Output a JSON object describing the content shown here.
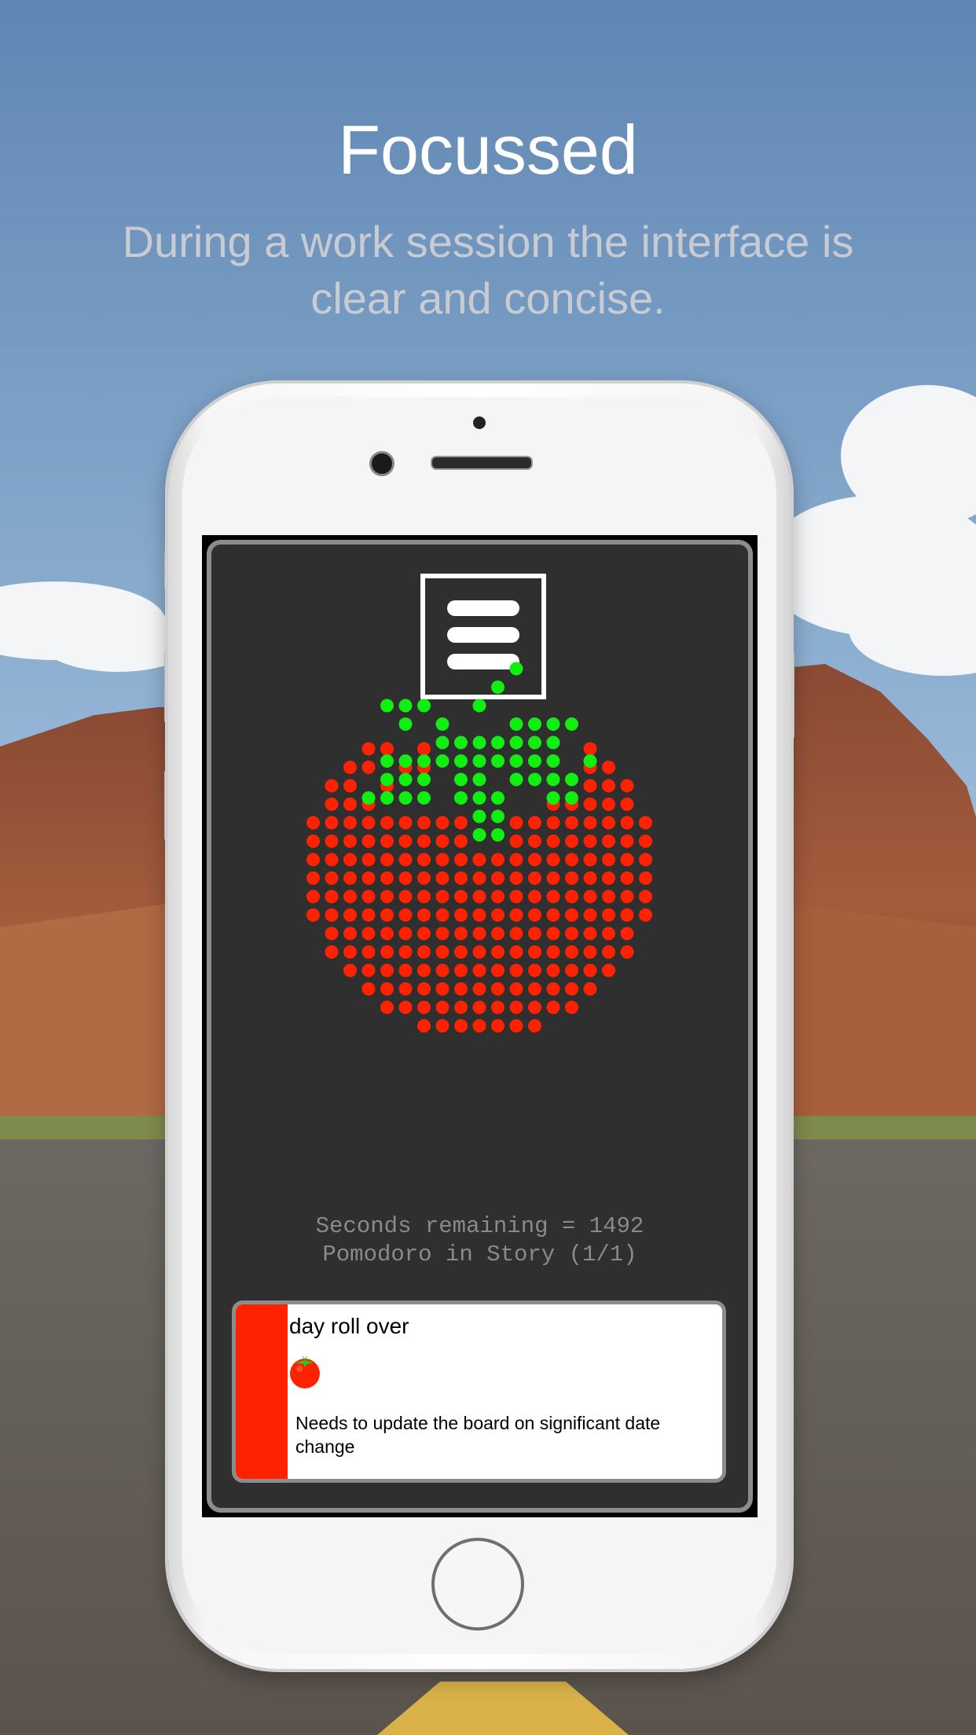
{
  "header": {
    "title": "Focussed",
    "subtitle": "During a work session the interface is clear and concise."
  },
  "app": {
    "menu_icon": "hamburger-menu-icon",
    "timer": {
      "seconds_line": "Seconds remaining = 1492",
      "pomodoro_line": "Pomodoro in Story (1/1)"
    },
    "story_card": {
      "title": "day roll over",
      "description": "Needs to update the board on significant date change",
      "status_icon": "tomato-icon"
    }
  },
  "colors": {
    "tomato_red": "#ff2200",
    "leaf_green": "#11ee11",
    "panel_bg": "#2f2f2f",
    "timer_text": "#8a8a8a"
  }
}
